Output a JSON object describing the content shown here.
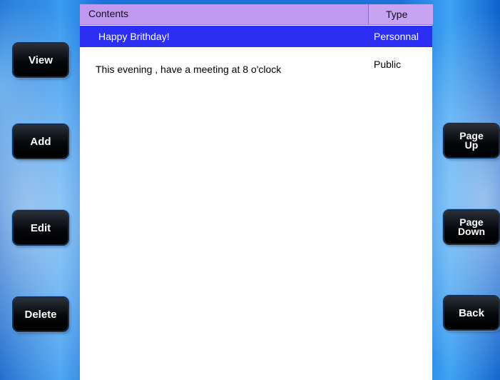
{
  "table": {
    "headers": {
      "contents": "Contents",
      "type": "Type"
    },
    "rows": [
      {
        "contents": "Happy Brithday!",
        "type": "Personnal",
        "selected": true
      },
      {
        "contents": "This evening , have a meeting at 8 o'clock",
        "type": "Public",
        "selected": false
      }
    ]
  },
  "left_buttons": {
    "view": "View",
    "add": "Add",
    "edit": "Edit",
    "delete": "Delete"
  },
  "right_buttons": {
    "page_up": "Page\nUp",
    "page_down": "Page\nDown",
    "back": "Back"
  },
  "colors": {
    "header": "#c09af0",
    "selected_row": "#2c2ff2",
    "background": "#1a73d8"
  }
}
